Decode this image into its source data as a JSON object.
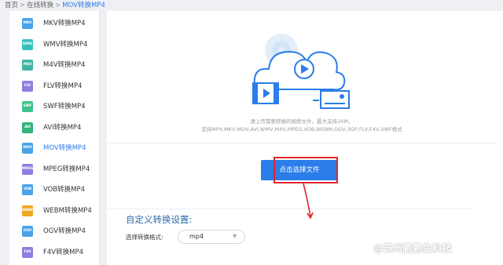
{
  "breadcrumb": {
    "home": "首页",
    "separator": ">",
    "section": "在线转换",
    "current": "MOV转换MP4"
  },
  "sidebar": {
    "items": [
      {
        "icon": "MKV",
        "label": "MKV转换MP4",
        "color": "#4aa3e8"
      },
      {
        "icon": "WMV",
        "label": "WMV转换MP4",
        "color": "#36c1c0"
      },
      {
        "icon": "M4V",
        "label": "M4V转换MP4",
        "color": "#3fb6a6"
      },
      {
        "icon": "FLV",
        "label": "FLV转换MP4",
        "color": "#8b7fe0"
      },
      {
        "icon": "SWF",
        "label": "SWF转换MP4",
        "color": "#3cc38a"
      },
      {
        "icon": "AVI",
        "label": "AVI转换MP4",
        "color": "#2fb57a"
      },
      {
        "icon": "MOV",
        "label": "MOV转换MP4",
        "color": "#4aa3e8",
        "active": true
      },
      {
        "icon": "MPEG",
        "label": "MPEG转换MP4",
        "color": "#8b7fe0"
      },
      {
        "icon": "VOB",
        "label": "VOB转换MP4",
        "color": "#4aa3e8"
      },
      {
        "icon": "WEBM",
        "label": "WEBM转换MP4",
        "color": "#f0a81f"
      },
      {
        "icon": "OGV",
        "label": "OGV转换MP4",
        "color": "#4aa3e8"
      },
      {
        "icon": "F4V",
        "label": "F4V转换MP4",
        "color": "#8b7fe0"
      }
    ]
  },
  "upload": {
    "instruction": "请上传需要转换的视频文件，最大支持20M，",
    "formats": "支持MP4,MKV,MOV,AVI,WMV,M4V,MPEG,VOB,WEBM,OGV,3GP,FLV,F4V,SWF格式",
    "button_label": "点击选择文件"
  },
  "settings": {
    "title": "自定义转换设置:",
    "format_label": "选择转换格式:",
    "format_value": "mp4"
  },
  "watermark": "@苏州鹏鹏鱼科技",
  "colors": {
    "accent": "#2b7de9",
    "highlight": "#e0262a"
  }
}
